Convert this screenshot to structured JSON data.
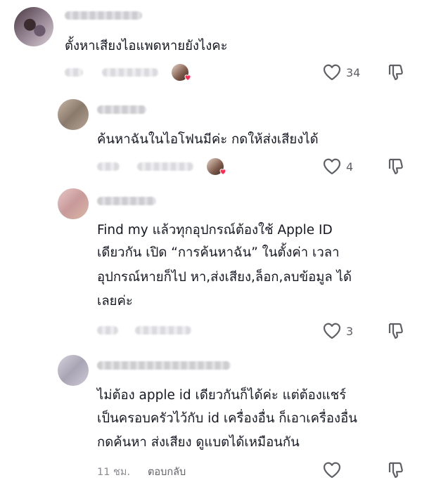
{
  "comments": [
    {
      "text": [
        "ตั้งหาเสียงไอแพดหายยังไงคะ"
      ],
      "likes": "34"
    },
    {
      "text": [
        "ค้นหาฉันในไอโฟนมีค่ะ กดให้ส่งเสียงได้"
      ],
      "likes": "4"
    },
    {
      "text": [
        "Find my แล้วทุกอุปกรณ์ต้องใช้ Apple ID",
        "เดียวกัน เปิด “การค้นหาฉัน” ในตั้งค่า เวลา",
        "อุปกรณ์หายก็ไป หา,ส่งเสียง,ล็อก,ลบข้อมูล ได้",
        "เลยค่ะ"
      ],
      "likes": "3"
    },
    {
      "text": [
        "ไม่ต้อง apple id เดียวกันก็ได้ค่ะ แต่ต้องแชร์",
        "เป็นครอบครัวไว้กับ id เครื่องอื่น ก็เอาเครื่องอื่น",
        "กดค้นหา ส่งเสียง ดูแบตได้เหมือนกัน"
      ],
      "time": "11 ชม.",
      "reply_label": "ตอบกลับ"
    }
  ],
  "icons": {
    "like": "heart-outline-icon",
    "dislike": "thumbs-down-icon",
    "creator_heart": "pink-heart-icon"
  },
  "colors": {
    "text": "#161823",
    "meta": "#8a8b91",
    "heart": "#fe2c55"
  }
}
